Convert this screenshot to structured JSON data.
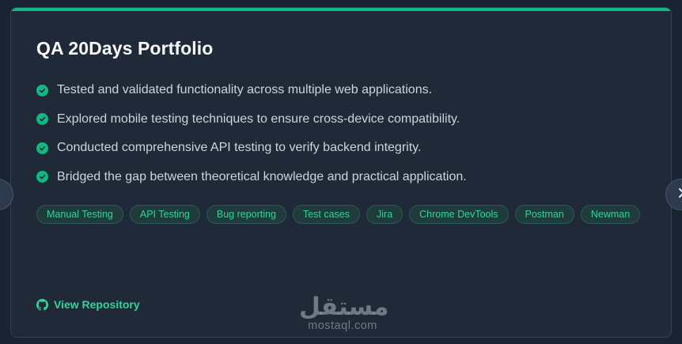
{
  "card": {
    "title": "QA 20Days Portfolio",
    "accent_color": "#10b981",
    "bullets": [
      "Tested and validated functionality across multiple web applications.",
      "Explored mobile testing techniques to ensure cross-device compatibility.",
      "Conducted comprehensive API testing to verify backend integrity.",
      "Bridged the gap between theoretical knowledge and practical application."
    ],
    "bullet_icon": "check-circle-icon",
    "tags": [
      "Manual Testing",
      "API Testing",
      "Bug reporting",
      "Test cases",
      "Jira",
      "Chrome DevTools",
      "Postman",
      "Newman"
    ],
    "repo_link": {
      "label": "View Repository",
      "icon": "github-icon"
    }
  },
  "carousel": {
    "prev_icon": "chevron-left-icon",
    "next_icon": "chevron-right-icon"
  },
  "watermark": {
    "arabic": "مستقل",
    "latin": "mostaql.com"
  }
}
